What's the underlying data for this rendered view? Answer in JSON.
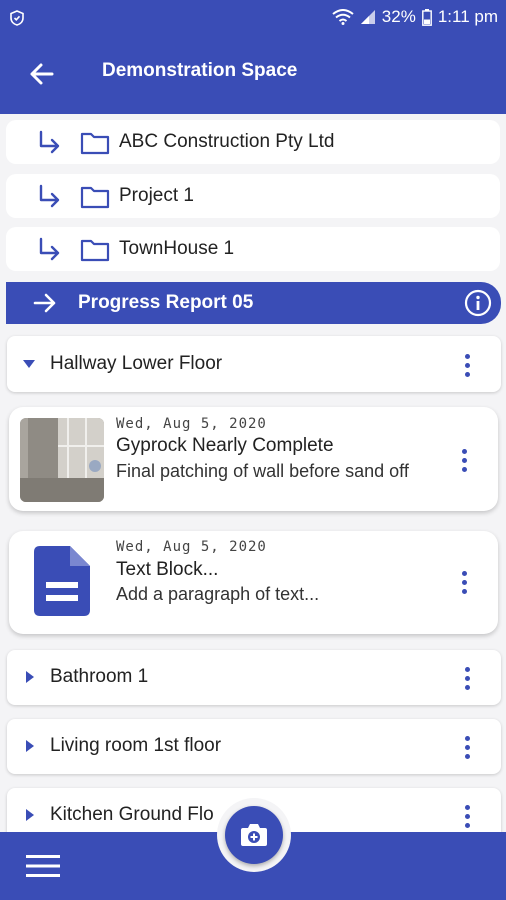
{
  "status_bar": {
    "battery": "32%",
    "time": "1:11 pm"
  },
  "header": {
    "title": "Demonstration Space"
  },
  "breadcrumbs": [
    {
      "label": "ABC Construction Pty Ltd"
    },
    {
      "label": "Project 1"
    },
    {
      "label": "TownHouse 1"
    }
  ],
  "current_report": {
    "label": "Progress Report 05"
  },
  "sections": {
    "expanded": {
      "label": "Hallway Lower Floor"
    },
    "collapsed": [
      {
        "label": "Bathroom 1"
      },
      {
        "label": "Living room 1st floor"
      },
      {
        "label": "Kitchen Ground Flo"
      }
    ]
  },
  "entries": [
    {
      "date": "Wed, Aug 5, 2020",
      "title": "Gyprock Nearly Complete",
      "description": "Final patching of wall before sand off",
      "thumbnail": "photo"
    },
    {
      "date": "Wed, Aug 5, 2020",
      "title": "Text Block...",
      "description": "Add a paragraph of text...",
      "thumbnail": "document-icon"
    }
  ],
  "colors": {
    "primary": "#3a4db6",
    "background": "#f4f4f6"
  }
}
